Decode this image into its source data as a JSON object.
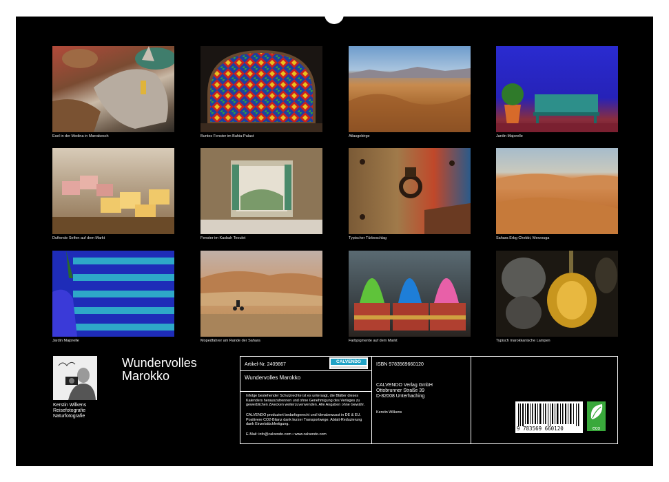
{
  "photos": [
    {
      "caption": "Esel in der Medina in Marrakesch"
    },
    {
      "caption": "Buntes Fenster im Bahia-Palast"
    },
    {
      "caption": "Atlasgebirge"
    },
    {
      "caption": "Jardin Majorelle"
    },
    {
      "caption": "Duftende Seifen auf dem Markt"
    },
    {
      "caption": "Fenster im Kasbah Teoulet"
    },
    {
      "caption": "Typischer Türbeschlag"
    },
    {
      "caption": "Sahara Erbg Chebbi, Merzouga"
    },
    {
      "caption": "Jardin Majorelle"
    },
    {
      "caption": "Mopedfahrer am Rande der Sahara"
    },
    {
      "caption": "Farbpigmente auf dem Markt"
    },
    {
      "caption": "Typisch marokkanische Lampen"
    }
  ],
  "calendar": {
    "title_line1": "Wundervolles",
    "title_line2": "Marokko"
  },
  "author": {
    "name": "Kerstin Wilkens",
    "line2": "Reisefotografie",
    "line3": "Naturfotografie",
    "signature": "Kerstin Wilkens"
  },
  "info": {
    "article": "Artikel-Nr. 2409867",
    "isbn": "ISBN 9783569660120",
    "calendar_name": "Wundervolles Marokko",
    "publisher_line1": "CALVENDO Verlag GmbH",
    "publisher_line2": "Ottobrunner Straße 39",
    "publisher_line3": "D-82008 Unterhaching",
    "legal": "Infolge bestehender Schutzrechte ist es untersagt, die Blätter dieses Kalenders herauszutrennen und ohne Genehmigung des Verlages zu gewerblichen Zwecken weiterzuverwenden. Alle Angaben ohne Gewähr.",
    "eco_text": "CALVENDO produziert bedarfsgerecht und klimabewusst in DE & EU. Positivere CO2-Bilanz dank kurzer Transportwege. Ablatt-Reduzierung dank Einzelstückfertigung.",
    "contact": "E-Mail: info@calvendo.com • www.calvendo.com",
    "author_small": "Kerstin Wilkens",
    "logo": "CALVENDO",
    "barcode_digits": "9 783569 660120",
    "eco_label": "eco"
  }
}
